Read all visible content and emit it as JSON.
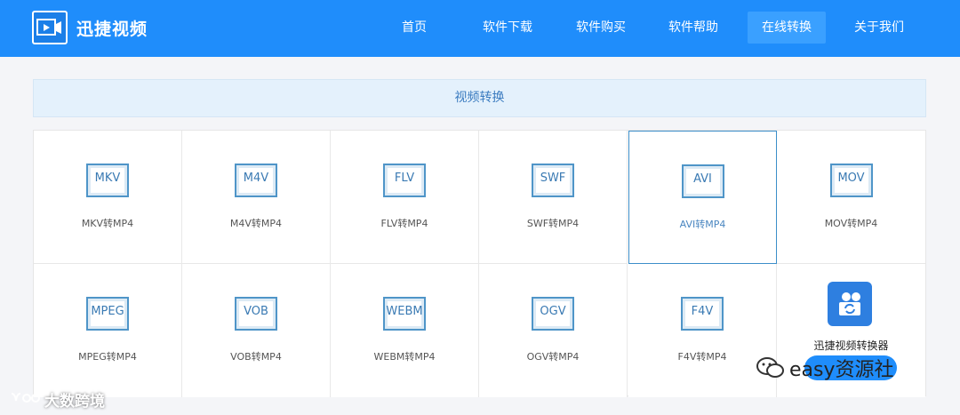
{
  "header": {
    "brand": "迅捷视频",
    "nav": [
      {
        "label": "首页",
        "active": false
      },
      {
        "label": "软件下载",
        "active": false
      },
      {
        "label": "软件购买",
        "active": false
      },
      {
        "label": "软件帮助",
        "active": false
      },
      {
        "label": "在线转换",
        "active": true
      },
      {
        "label": "关于我们",
        "active": false
      }
    ]
  },
  "section": {
    "title": "视频转换"
  },
  "formats": [
    {
      "icon": "MKV",
      "label": "MKV转MP4",
      "selected": false
    },
    {
      "icon": "M4V",
      "label": "M4V转MP4",
      "selected": false
    },
    {
      "icon": "FLV",
      "label": "FLV转MP4",
      "selected": false
    },
    {
      "icon": "SWF",
      "label": "SWF转MP4",
      "selected": false
    },
    {
      "icon": "AVI",
      "label": "AVI转MP4",
      "selected": true
    },
    {
      "icon": "MOV",
      "label": "MOV转MP4",
      "selected": false
    },
    {
      "icon": "MPEG",
      "label": "MPEG转MP4",
      "selected": false
    },
    {
      "icon": "VOB",
      "label": "VOB转MP4",
      "selected": false
    },
    {
      "icon": "WEBM",
      "label": "WEBM转MP4",
      "selected": false
    },
    {
      "icon": "OGV",
      "label": "OGV转MP4",
      "selected": false
    },
    {
      "icon": "F4V",
      "label": "F4V转MP4",
      "selected": false
    }
  ],
  "promo": {
    "label": "迅捷视频转换器"
  },
  "watermarks": {
    "left": "大数跨境",
    "right": "easy资源社"
  },
  "colors": {
    "header": "#1f8dfb",
    "accent": "#3c8ec9",
    "icon_border": "#4f95c8"
  }
}
